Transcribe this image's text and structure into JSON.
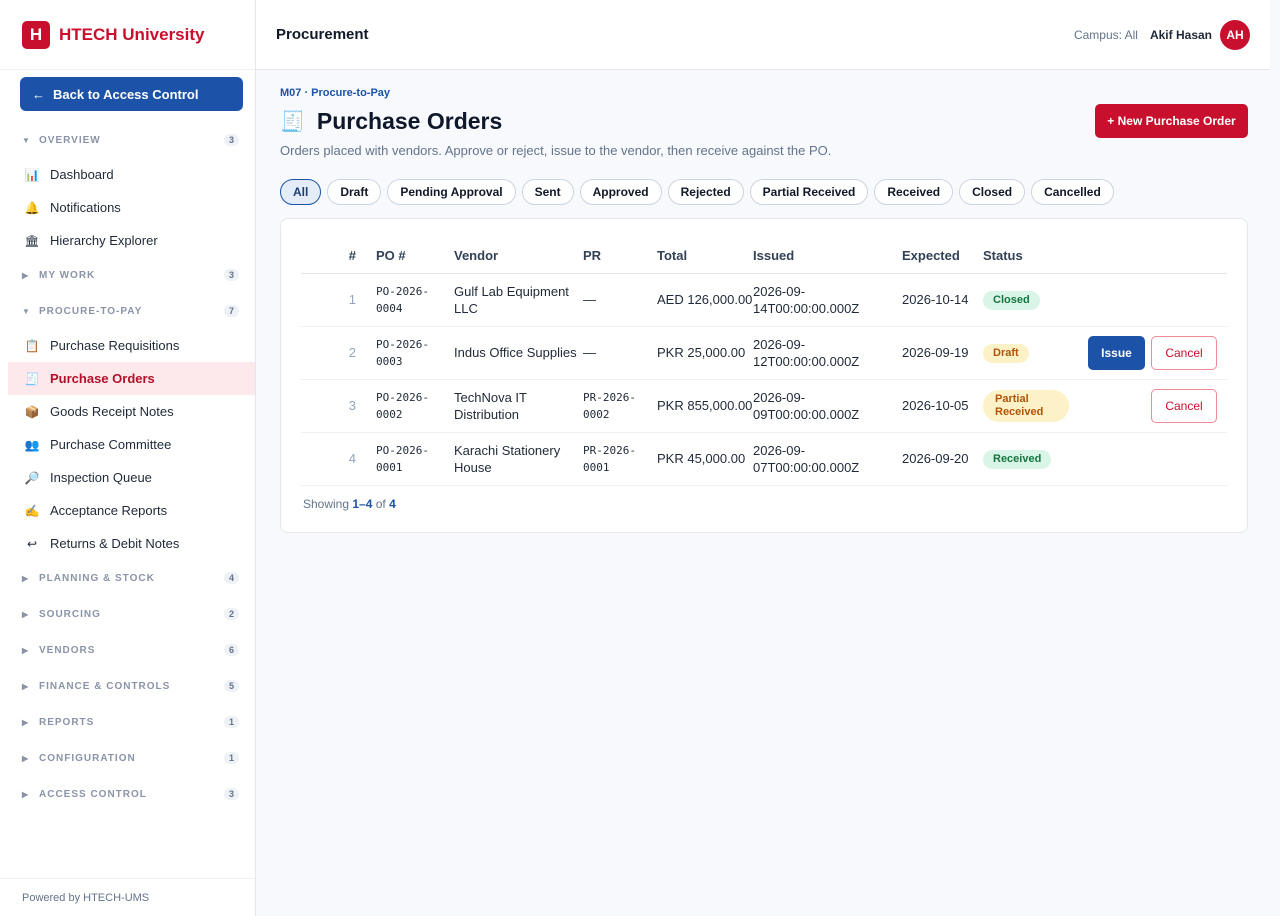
{
  "brand": {
    "logo_letter": "H",
    "name": "HTECH University"
  },
  "sidebar": {
    "back_label": "Back to Access Control",
    "sections": [
      {
        "label": "OVERVIEW",
        "count": "3",
        "expanded": true,
        "items": [
          {
            "label": "Dashboard",
            "icon": "chart-icon",
            "glyph": "📊"
          },
          {
            "label": "Notifications",
            "icon": "bell-icon",
            "glyph": "🔔"
          },
          {
            "label": "Hierarchy Explorer",
            "icon": "bank-icon",
            "glyph": "🏛"
          }
        ]
      },
      {
        "label": "MY WORK",
        "count": "3",
        "expanded": false,
        "items": []
      },
      {
        "label": "PROCURE-TO-PAY",
        "count": "7",
        "expanded": true,
        "items": [
          {
            "label": "Purchase Requisitions",
            "icon": "clipboard-icon",
            "glyph": "📋"
          },
          {
            "label": "Purchase Orders",
            "icon": "receipt-icon",
            "glyph": "🧾",
            "active": true
          },
          {
            "label": "Goods Receipt Notes",
            "icon": "package-icon",
            "glyph": "📦"
          },
          {
            "label": "Purchase Committee",
            "icon": "people-icon",
            "glyph": "👥"
          },
          {
            "label": "Inspection Queue",
            "icon": "magnifier-icon",
            "glyph": "🔎"
          },
          {
            "label": "Acceptance Reports",
            "icon": "writing-hand-icon",
            "glyph": "✍"
          },
          {
            "label": "Returns & Debit Notes",
            "icon": "return-icon",
            "glyph": "↩"
          }
        ]
      },
      {
        "label": "PLANNING & STOCK",
        "count": "4",
        "expanded": false,
        "items": []
      },
      {
        "label": "SOURCING",
        "count": "2",
        "expanded": false,
        "items": []
      },
      {
        "label": "VENDORS",
        "count": "6",
        "expanded": false,
        "items": []
      },
      {
        "label": "FINANCE & CONTROLS",
        "count": "5",
        "expanded": false,
        "items": []
      },
      {
        "label": "REPORTS",
        "count": "1",
        "expanded": false,
        "items": []
      },
      {
        "label": "CONFIGURATION",
        "count": "1",
        "expanded": false,
        "items": []
      },
      {
        "label": "ACCESS CONTROL",
        "count": "3",
        "expanded": false,
        "items": []
      }
    ],
    "footer": "Powered by HTECH-UMS"
  },
  "topbar": {
    "title": "Procurement",
    "campus": "Campus: All",
    "user": "Akif Hasan",
    "avatar": "AH"
  },
  "page": {
    "breadcrumb": "M07 · Procure-to-Pay",
    "icon_glyph": "🧾",
    "title": "Purchase Orders",
    "subtitle": "Orders placed with vendors. Approve or reject, issue to the vendor, then receive against the PO.",
    "new_button": "+ New Purchase Order"
  },
  "filters": [
    "All",
    "Draft",
    "Pending Approval",
    "Sent",
    "Approved",
    "Rejected",
    "Partial Received",
    "Received",
    "Closed",
    "Cancelled"
  ],
  "active_filter": "All",
  "table": {
    "headers": [
      "#",
      "PO #",
      "Vendor",
      "PR",
      "Total",
      "Issued",
      "Expected",
      "Status"
    ],
    "rows": [
      {
        "n": "1",
        "po": "PO-2026-0004",
        "vendor": "Gulf Lab Equipment LLC",
        "pr": "—",
        "total": "AED 126,000.00",
        "issued": "2026-09-14T00:00:00.000Z",
        "expected": "2026-10-14",
        "status": "Closed",
        "status_class": "b-closed",
        "actions": []
      },
      {
        "n": "2",
        "po": "PO-2026-0003",
        "vendor": "Indus Office Supplies",
        "pr": "—",
        "total": "PKR 25,000.00",
        "issued": "2026-09-12T00:00:00.000Z",
        "expected": "2026-09-19",
        "status": "Draft",
        "status_class": "b-draft",
        "actions": [
          "Issue",
          "Cancel"
        ]
      },
      {
        "n": "3",
        "po": "PO-2026-0002",
        "vendor": "TechNova IT Distribution",
        "pr": "PR-2026-0002",
        "total": "PKR 855,000.00",
        "issued": "2026-09-09T00:00:00.000Z",
        "expected": "2026-10-05",
        "status": "Partial Received",
        "status_class": "b-partial",
        "actions": [
          "Cancel"
        ]
      },
      {
        "n": "4",
        "po": "PO-2026-0001",
        "vendor": "Karachi Stationery House",
        "pr": "PR-2026-0001",
        "total": "PKR 45,000.00",
        "issued": "2026-09-07T00:00:00.000Z",
        "expected": "2026-09-20",
        "status": "Received",
        "status_class": "b-received",
        "actions": []
      }
    ]
  },
  "pagination": {
    "prefix": "Showing",
    "range": "1–4",
    "of": "of",
    "total": "4"
  },
  "colors": {
    "brand_red": "#c8102e",
    "primary_blue": "#1c53a8"
  }
}
